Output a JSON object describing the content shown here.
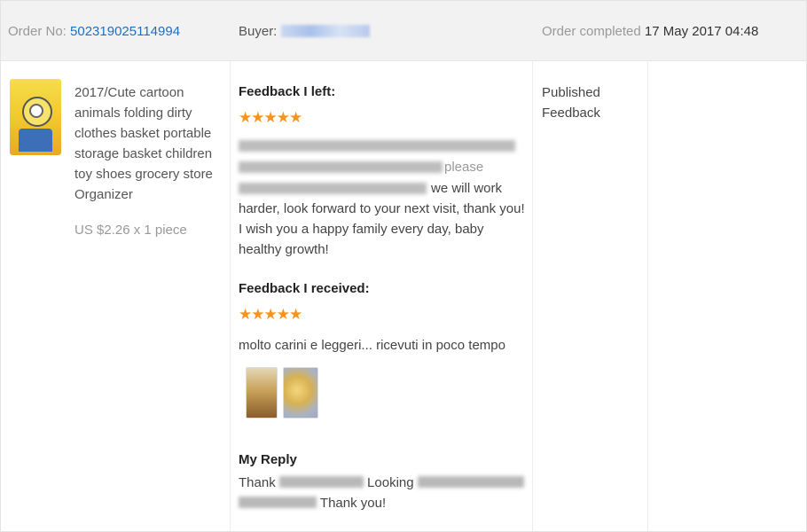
{
  "header": {
    "order_label": "Order No:",
    "order_number": "502319025114994",
    "buyer_label": "Buyer:",
    "buyer_name_hidden": "",
    "completed_label": "Order completed",
    "completed_date": "17 May 2017 04:48"
  },
  "product": {
    "title": "2017/Cute cartoon animals folding dirty clothes basket portable storage basket children toy shoes grocery store Organizer",
    "price": "US $2.26 x 1 piece"
  },
  "feedback_left": {
    "heading": "Feedback I left:",
    "stars": "★★★★★",
    "line3_visible": "we will work",
    "line3_prefix_visible": "",
    "line2_visible": "please",
    "text_rest": "harder, look forward to your next visit, thank you! I wish you a happy family every day, baby healthy growth!"
  },
  "feedback_received": {
    "heading": "Feedback I received:",
    "stars": "★★★★★",
    "text": "molto carini e leggeri... ricevuti in poco tempo"
  },
  "reply": {
    "heading": "My Reply",
    "part1": "Thank",
    "part2": "Looking",
    "part3": "Thank you!"
  },
  "status": {
    "text": "Published Feedback"
  },
  "colors": {
    "link": "#1f6fbf",
    "star": "#f7941d",
    "header_bg": "#f2f2f2"
  }
}
